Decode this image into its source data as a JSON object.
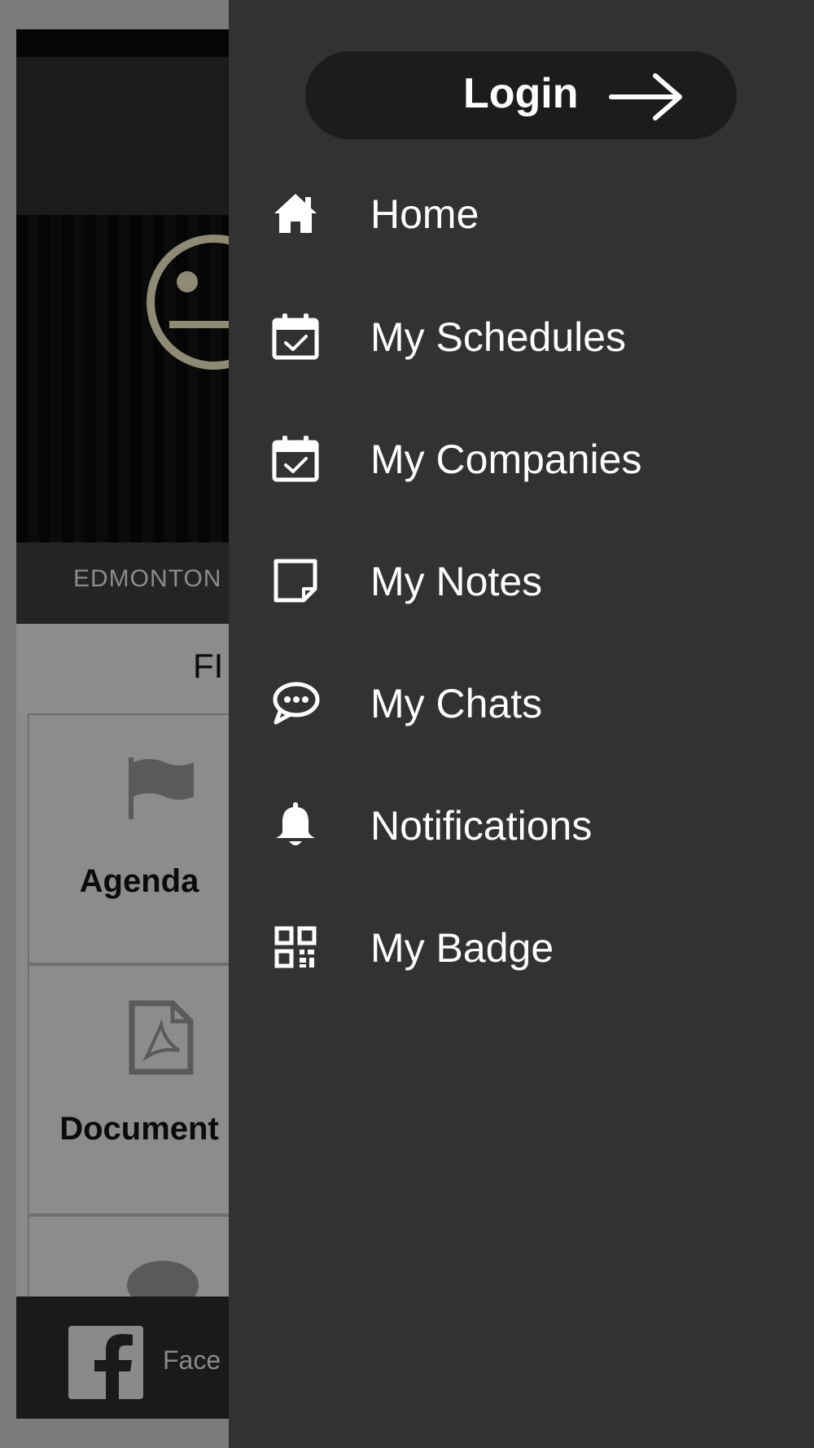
{
  "background_app": {
    "location_caption": "EDMONTON",
    "section_title": "FI",
    "tiles": [
      {
        "label": "Agenda",
        "icon": "flag-icon"
      },
      {
        "label": "Document",
        "icon": "pdf-document-icon"
      },
      {
        "label": "",
        "icon": "speech-bubble-icon"
      }
    ],
    "footer": {
      "label": "Face",
      "icon": "facebook-icon"
    }
  },
  "drawer": {
    "login_label": "Login",
    "items": [
      {
        "label": "Home",
        "icon": "home-icon"
      },
      {
        "label": "My Schedules",
        "icon": "calendar-check-icon"
      },
      {
        "label": "My Companies",
        "icon": "calendar-check-icon"
      },
      {
        "label": "My Notes",
        "icon": "sticky-note-icon"
      },
      {
        "label": "My Chats",
        "icon": "chat-bubble-icon"
      },
      {
        "label": "Notifications",
        "icon": "bell-icon"
      },
      {
        "label": "My Badge",
        "icon": "qr-code-icon"
      }
    ]
  },
  "colors": {
    "drawer_background": "#333233",
    "login_button": "#1c1c1c",
    "text": "#ffffff",
    "overlay_dim": "#7a7b7d"
  }
}
